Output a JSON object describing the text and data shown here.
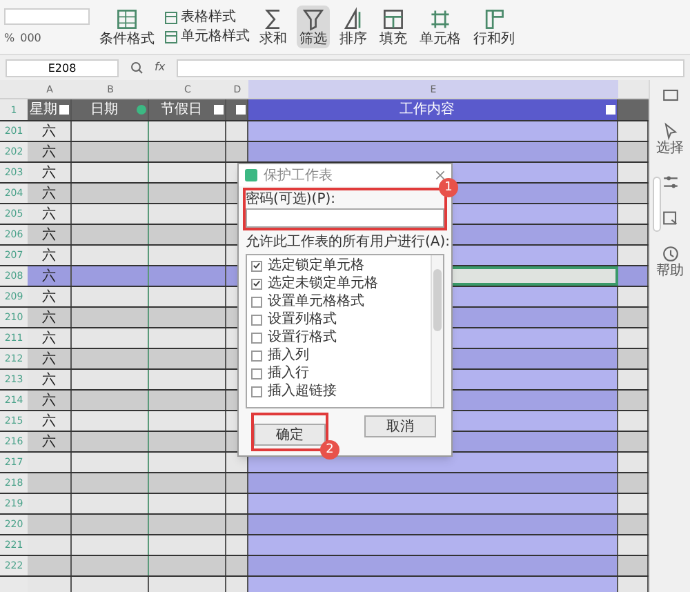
{
  "toolbar": {
    "buttons": [
      {
        "label": "条件格式",
        "active": false
      },
      {
        "label": "求和",
        "active": false
      },
      {
        "label": "筛选",
        "active": true
      },
      {
        "label": "排序",
        "active": false
      },
      {
        "label": "填充",
        "active": false
      },
      {
        "label": "单元格",
        "active": false
      },
      {
        "label": "行和列",
        "active": false
      }
    ],
    "style_menus": [
      {
        "label": "表格样式"
      },
      {
        "label": "单元格样式"
      }
    ],
    "number_formats": [
      "%",
      "000"
    ]
  },
  "formula_bar": {
    "name_box": "E208",
    "fx": "fx"
  },
  "columns": [
    {
      "letter": "A",
      "header": "星期",
      "filtered": false
    },
    {
      "letter": "B",
      "header": "日期",
      "filtered": true
    },
    {
      "letter": "C",
      "header": "节假日",
      "filtered": false
    },
    {
      "letter": "D",
      "filtered": false
    },
    {
      "letter": "E",
      "header": "工作内容",
      "filtered": false
    }
  ],
  "header_row": "1",
  "rows": [
    {
      "num": "201",
      "weekday": "六",
      "selected": false
    },
    {
      "num": "202",
      "weekday": "六",
      "selected": false
    },
    {
      "num": "203",
      "weekday": "六",
      "selected": false
    },
    {
      "num": "204",
      "weekday": "六",
      "selected": false
    },
    {
      "num": "205",
      "weekday": "六",
      "selected": false
    },
    {
      "num": "206",
      "weekday": "六",
      "selected": false
    },
    {
      "num": "207",
      "weekday": "六",
      "selected": false
    },
    {
      "num": "208",
      "weekday": "六",
      "selected": true
    },
    {
      "num": "209",
      "weekday": "六",
      "selected": false
    },
    {
      "num": "210",
      "weekday": "六",
      "selected": false
    },
    {
      "num": "211",
      "weekday": "六",
      "selected": false
    },
    {
      "num": "212",
      "weekday": "六",
      "selected": false
    },
    {
      "num": "213",
      "weekday": "六",
      "selected": false
    },
    {
      "num": "214",
      "weekday": "六",
      "selected": false
    },
    {
      "num": "215",
      "weekday": "六",
      "selected": false
    },
    {
      "num": "216",
      "weekday": "六",
      "selected": false
    },
    {
      "num": "217",
      "selected": false
    },
    {
      "num": "218",
      "selected": false
    },
    {
      "num": "219",
      "selected": false
    },
    {
      "num": "220",
      "selected": false
    },
    {
      "num": "221",
      "selected": false
    },
    {
      "num": "222",
      "selected": false
    }
  ],
  "sidebar": [
    {
      "label": "选择"
    },
    {
      "label": "帮助"
    }
  ],
  "dialog": {
    "title": "保护工作表",
    "password_label": "密码(可选)(P):",
    "permissions_label": "允许此工作表的所有用户进行(A):",
    "permissions": [
      {
        "label": "选定锁定单元格",
        "checked": true
      },
      {
        "label": "选定未锁定单元格",
        "checked": true
      },
      {
        "label": "设置单元格格式",
        "checked": false
      },
      {
        "label": "设置列格式",
        "checked": false
      },
      {
        "label": "设置行格式",
        "checked": false
      },
      {
        "label": "插入列",
        "checked": false
      },
      {
        "label": "插入行",
        "checked": false
      },
      {
        "label": "插入超链接",
        "checked": false
      }
    ],
    "ok": "确定",
    "cancel": "取消"
  },
  "annotations": [
    {
      "label": "1"
    },
    {
      "label": "2"
    }
  ]
}
